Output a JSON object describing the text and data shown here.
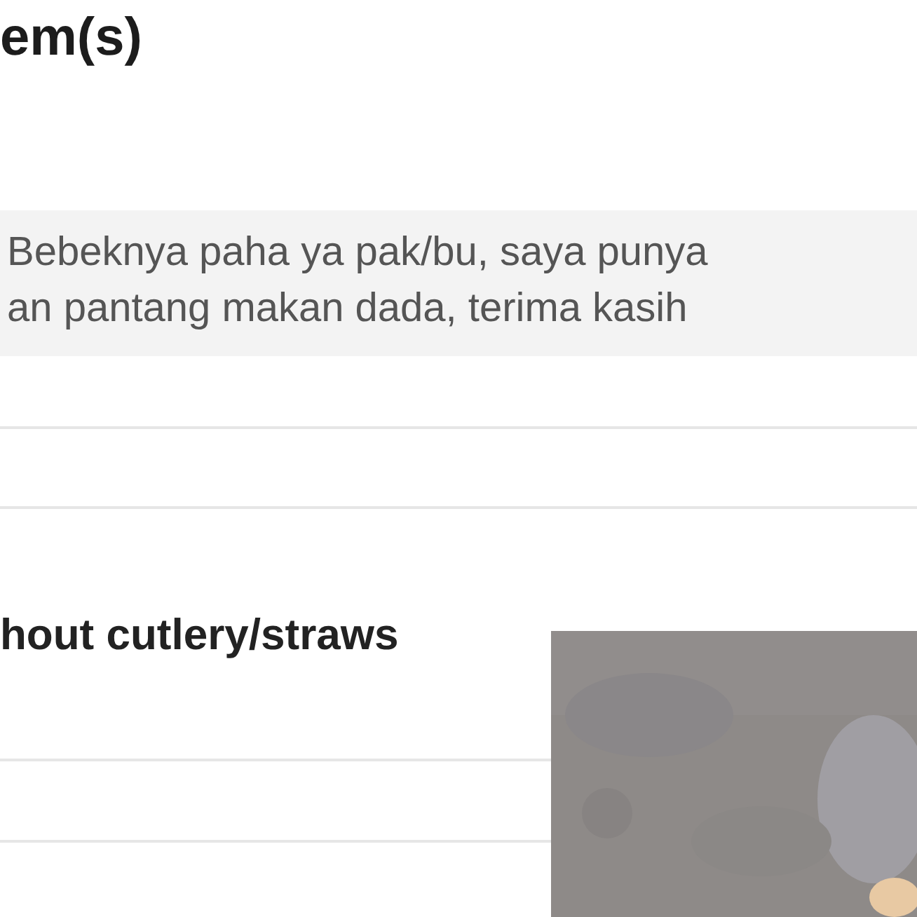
{
  "section_title": "em(s)",
  "note_lines": [
    "Bebeknya paha ya pak/bu, saya punya",
    "an pantang makan dada, terima kasih"
  ],
  "cutlery_option": "hout cutlery/straws"
}
